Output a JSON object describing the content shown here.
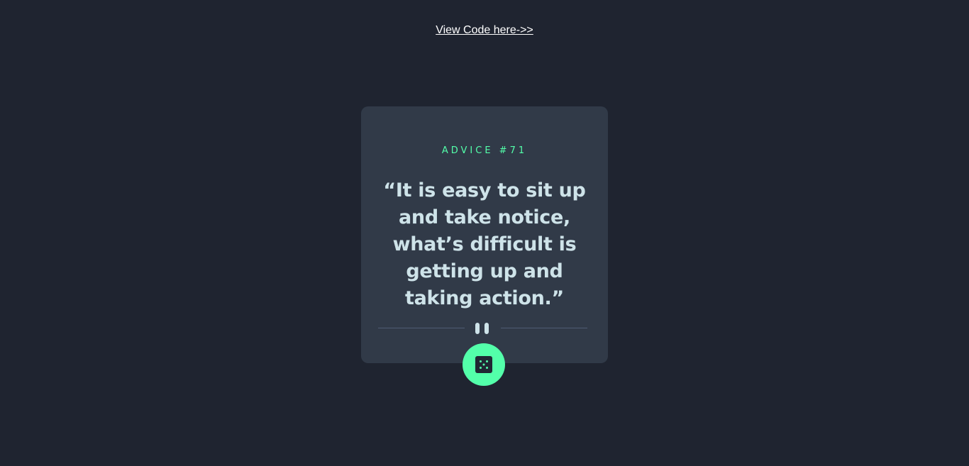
{
  "header": {
    "link_text": "View Code here->>"
  },
  "card": {
    "advice_label": "ADVICE #71",
    "quote": "“It is easy to sit up and take notice, what’s difficult is getting up and taking action.”"
  },
  "controls": {
    "divider_icon": "pause-icon",
    "dice_icon": "dice-icon"
  },
  "colors": {
    "background": "#1f2430",
    "card": "#313a48",
    "accent": "#53ffaa",
    "quote_text": "#cee3e9",
    "divider": "#4f5d74"
  }
}
